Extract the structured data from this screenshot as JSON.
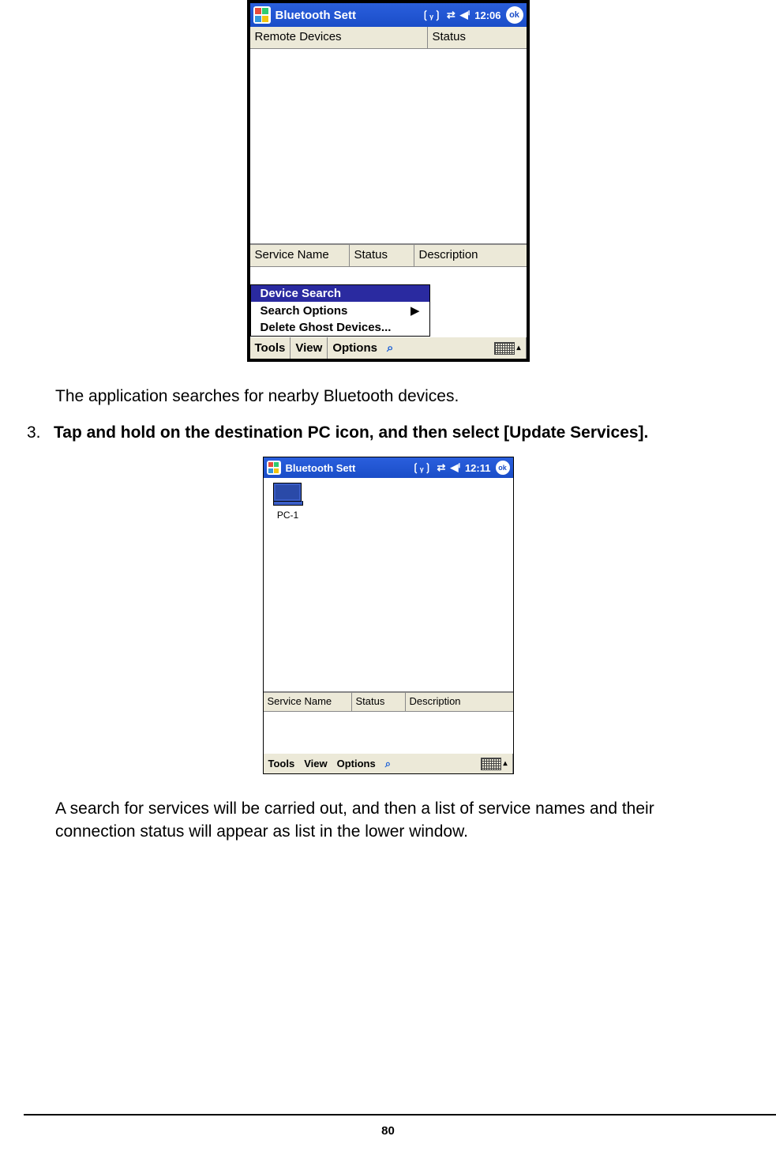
{
  "screenshot1": {
    "titlebar": {
      "title": "Bluetooth Sett",
      "time": "12:06",
      "ok": "ok"
    },
    "upper_headers": [
      "Remote Devices",
      "Status"
    ],
    "lower_headers": [
      "Service Name",
      "Status",
      "Description"
    ],
    "popup": {
      "items": [
        {
          "label": "Device Search",
          "selected": true,
          "submenu": false
        },
        {
          "label": "Search Options",
          "selected": false,
          "submenu": true
        },
        {
          "label": "Delete Ghost Devices...",
          "selected": false,
          "submenu": false
        }
      ]
    },
    "bottombar": {
      "tools": "Tools",
      "view": "View",
      "options": "Options"
    }
  },
  "caption1": "The application searches for nearby Bluetooth devices.",
  "step3": {
    "number": "3.",
    "text": "Tap and hold on the destination PC icon, and then select [Update Services]."
  },
  "screenshot2": {
    "titlebar": {
      "title": "Bluetooth Sett",
      "time": "12:11",
      "ok": "ok"
    },
    "device_icon_label": "PC-1",
    "lower_headers": [
      "Service Name",
      "Status",
      "Description"
    ],
    "bottombar": {
      "tools": "Tools",
      "view": "View",
      "options": "Options"
    }
  },
  "caption2": "A search for services will be carried out, and then a list of service names and their connection status will appear as list in the lower window.",
  "page_number": "80"
}
